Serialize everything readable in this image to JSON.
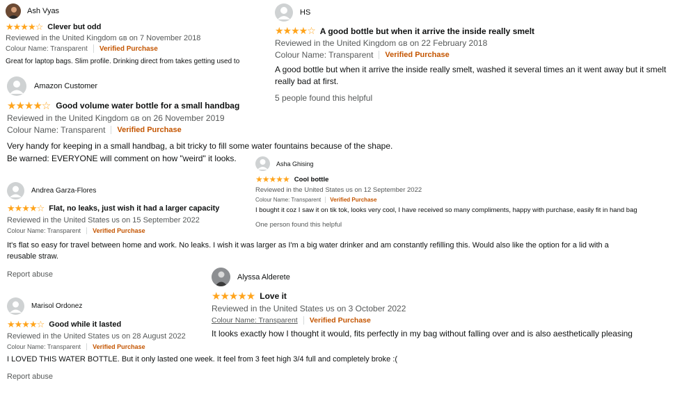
{
  "reviews": [
    {
      "name": "Ash Vyas",
      "stars": "★★★★☆",
      "rating": 4,
      "title": "Clever but odd",
      "meta": "Reviewed in the United Kingdom ɢʙ on 7 November 2018",
      "colour_label": "Colour Name: Transparent",
      "verified": "Verified Purchase",
      "body": "Great for laptop bags. Slim profile. Drinking direct from takes getting used to"
    },
    {
      "name": "HS",
      "stars": "★★★★☆",
      "rating": 4,
      "title": "A good bottle but when it arrive the inside really smelt",
      "meta": "Reviewed in the United Kingdom ɢʙ on 22 February 2018",
      "colour_label": "Colour Name: Transparent",
      "verified": "Verified Purchase",
      "body": "A good bottle but when it arrive the inside really smelt, washed it several times an it went away but it smelt really bad at first.",
      "helpful": "5 people found this helpful"
    },
    {
      "name": "Amazon Customer",
      "stars": "★★★★☆",
      "rating": 4,
      "title": "Good volume water bottle for a small handbag",
      "meta": "Reviewed in the United Kingdom ɢʙ on 26 November 2019",
      "colour_label": "Colour Name: Transparent",
      "verified": "Verified Purchase",
      "body_lines": [
        "Very handy for keeping in a small handbag, a bit tricky to fill some water fountains because of the shape.",
        "Be warned: EVERYONE will comment on how \"weird\" it looks."
      ]
    },
    {
      "name": "Asha Ghising",
      "stars": "★★★★★",
      "rating": 5,
      "title": "Cool bottle",
      "meta": "Reviewed in the United States ᴜs on 12 September 2022",
      "colour_label": "Colour Name: Transparent",
      "verified": "Verified Purchase",
      "body": "I bought it coz I saw it on tik tok, looks very cool, I have received so many compliments, happy with purchase, easily fit in hand bag",
      "helpful": "One person found this helpful"
    },
    {
      "name": "Andrea Garza-Flores",
      "stars": "★★★★☆",
      "rating": 4,
      "title": "Flat, no leaks, just wish it had a larger capacity",
      "meta": "Reviewed in the United States ᴜs on 15 September 2022",
      "colour_label": "Colour Name: Transparent",
      "verified": "Verified Purchase",
      "body": "It's flat so easy for travel between home and work. No leaks. I wish it was larger as I'm a big water drinker and am constantly refilling this. Would also like the option for a lid with a reusable straw.",
      "report": "Report abuse"
    },
    {
      "name": "Alyssa Alderete",
      "stars": "★★★★★",
      "rating": 5,
      "title": "Love it",
      "meta": "Reviewed in the United States ᴜs on 3 October 2022",
      "colour_label": "Colour Name: Transparent",
      "verified": "Verified Purchase",
      "body": "It looks exactly how I thought it would, fits perfectly in my bag without falling over and is also aesthetically pleasing"
    },
    {
      "name": "Marisol Ordonez",
      "stars": "★★★★☆",
      "rating": 4,
      "title": "Good while it lasted",
      "meta": "Reviewed in the United States ᴜs on 28 August 2022",
      "colour_label": "Colour Name: Transparent",
      "verified": "Verified Purchase",
      "body": "I LOVED THIS WATER BOTTLE. But it only lasted one week. It feel from 3 feet high 3/4 full and completely broke :(",
      "report": "Report abuse"
    }
  ],
  "colors": {
    "star": "#ffa41c",
    "verified": "#c45500",
    "meta": "#565959",
    "text": "#0f1111"
  }
}
